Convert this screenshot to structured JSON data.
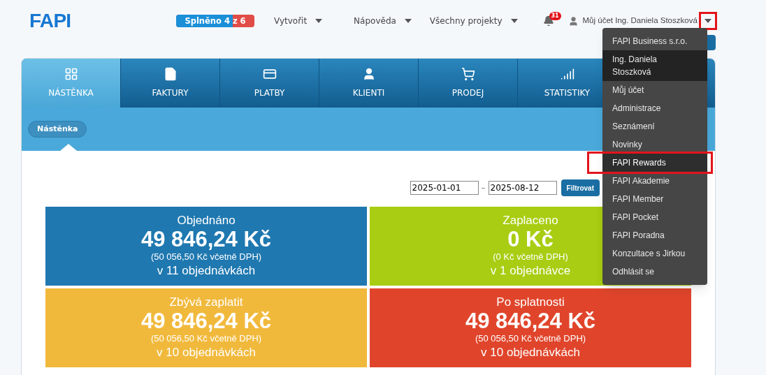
{
  "logo": "FAPI",
  "progress": {
    "label": "Splněno 4 z 6",
    "level": 0.72
  },
  "nav": [
    {
      "label": "Vytvořit"
    },
    {
      "label": "Nápověda"
    },
    {
      "label": "Všechny projekty"
    }
  ],
  "notifications": {
    "count": "31"
  },
  "account": {
    "label": "Můj účet Ing. Daniela Stoszková",
    "highlighted": true
  },
  "tabs": [
    {
      "label": "NÁSTĚNKA",
      "selected": true
    },
    {
      "label": "FAKTURY",
      "selected": false
    },
    {
      "label": "PLATBY",
      "selected": false
    },
    {
      "label": "KLIENTI",
      "selected": false
    },
    {
      "label": "PRODEJ",
      "selected": false
    },
    {
      "label": "STATISTIKY",
      "selected": false
    }
  ],
  "breadcrumb": "Nástěnka",
  "filter": {
    "from": "2025-01-01",
    "separator": "–",
    "to": "2025-08-12",
    "button": "Filtrovat"
  },
  "cards": [
    {
      "title": "Objednáno",
      "amount": "49 846,24 Kč",
      "vat": "(50 056,50 Kč včetně DPH)",
      "count": "v 11 objednávkách",
      "color": "#1f78b0"
    },
    {
      "title": "Zaplaceno",
      "amount": "0 Kč",
      "vat": "(0 Kč včetně DPH)",
      "count": "v 1 objednávce",
      "color": "#a8cd12"
    },
    {
      "title": "Zbývá zaplatit",
      "amount": "49 846,24 Kč",
      "vat": "(50 056,50 Kč včetně DPH)",
      "count": "v 10 objednávkách",
      "color": "#f1b93c"
    },
    {
      "title": "Po splatnosti",
      "amount": "49 846,24 Kč",
      "vat": "(50 056,50 Kč včetně DPH)",
      "count": "v 10 objednávkách",
      "color": "#e0452b"
    }
  ],
  "menu": [
    {
      "label": "FAPI Business s.r.o.",
      "selected": false,
      "highlighted": false
    },
    {
      "label": "Ing. Daniela Stoszková",
      "selected": true,
      "highlighted": false
    },
    {
      "label": "Můj účet",
      "selected": false,
      "highlighted": false
    },
    {
      "label": "Administrace",
      "selected": false,
      "highlighted": false
    },
    {
      "label": "Seznámení",
      "selected": false,
      "highlighted": false
    },
    {
      "label": "Novinky",
      "selected": false,
      "highlighted": false
    },
    {
      "label": "FAPI Rewards",
      "selected": false,
      "highlighted": true
    },
    {
      "label": "FAPI Akademie",
      "selected": false,
      "highlighted": false
    },
    {
      "label": "FAPI Member",
      "selected": false,
      "highlighted": false
    },
    {
      "label": "FAPI Pocket",
      "selected": false,
      "highlighted": false
    },
    {
      "label": "FAPI Poradna",
      "selected": false,
      "highlighted": false
    },
    {
      "label": "Konzultace s Jirkou",
      "selected": false,
      "highlighted": false
    },
    {
      "label": "Odhlásit se",
      "selected": false,
      "highlighted": false
    }
  ]
}
